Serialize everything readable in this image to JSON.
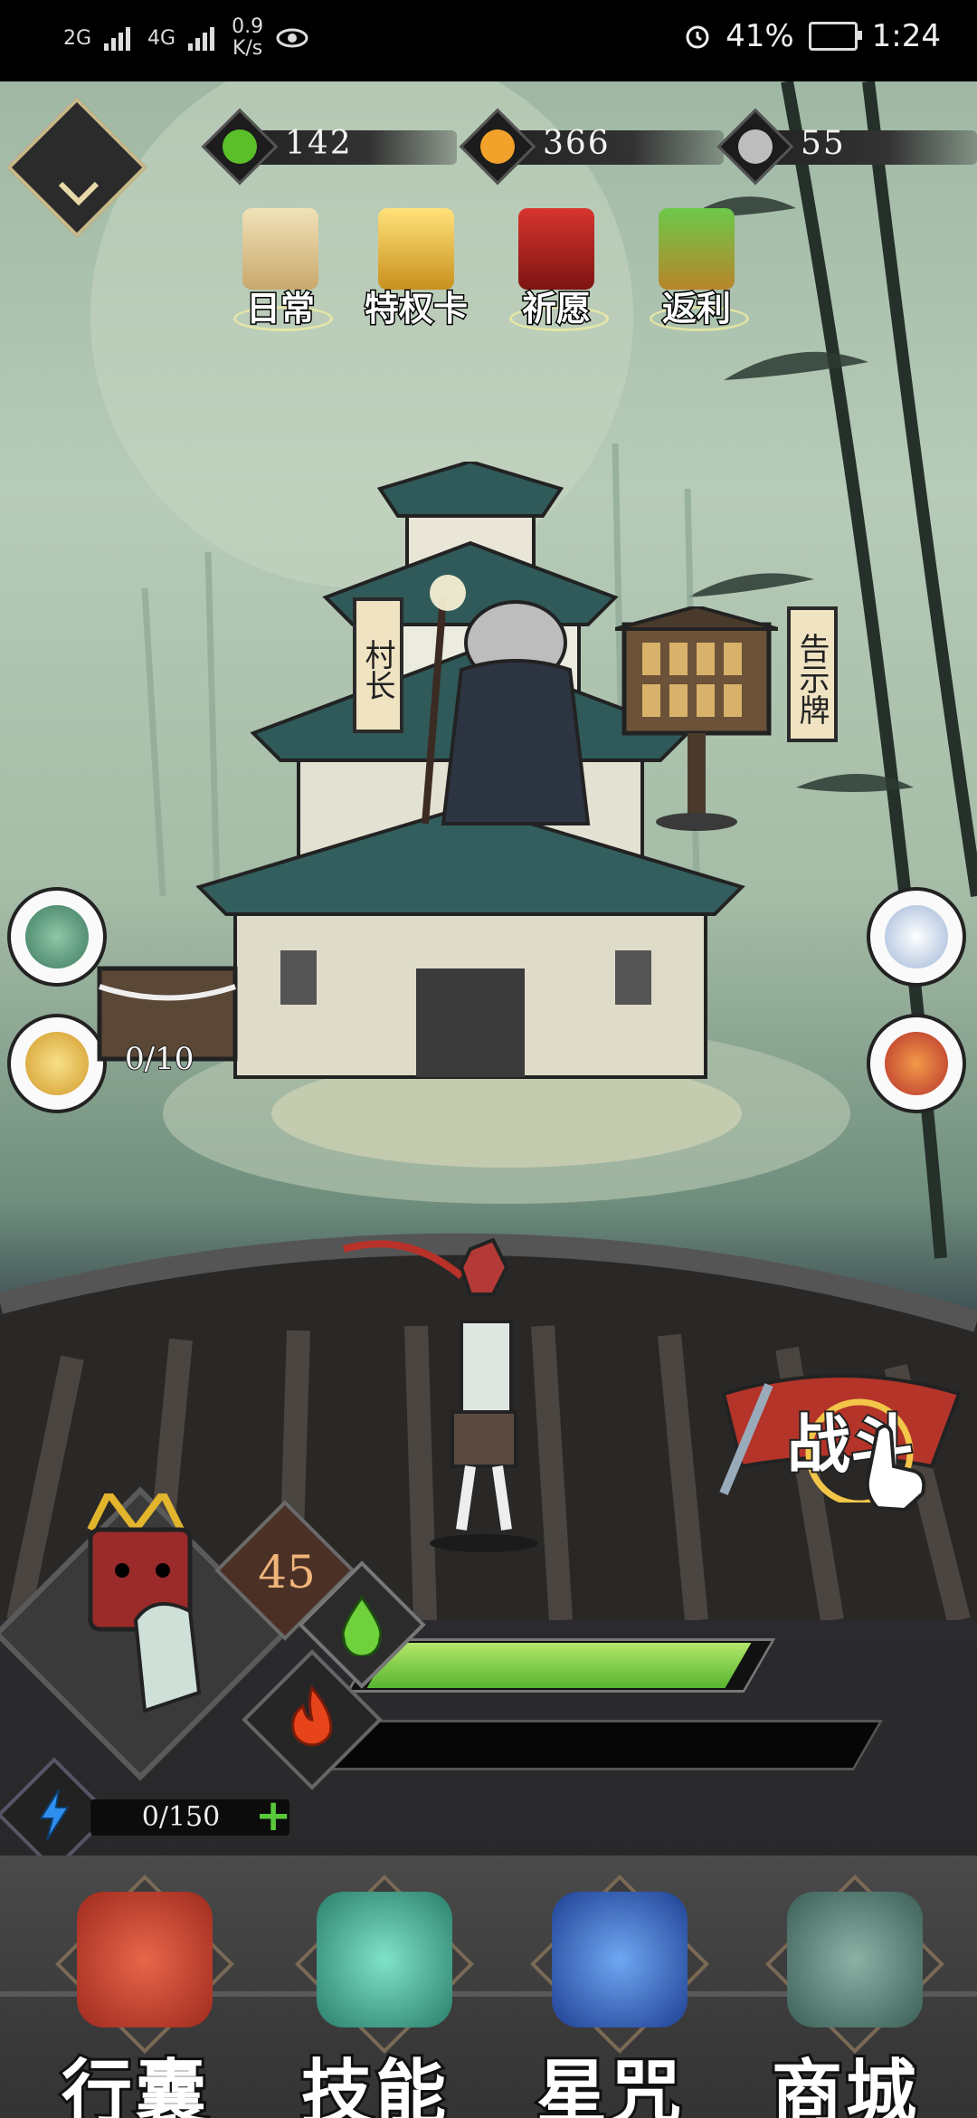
{
  "status_bar": {
    "net_type_1": "2G",
    "net_type_2": "4G",
    "speed": "0.9",
    "speed_unit": "K/s",
    "battery": "41%",
    "time": "1:24"
  },
  "currencies": [
    {
      "name": "jade",
      "value": "142",
      "color": "#5bbf2a"
    },
    {
      "name": "coin",
      "value": "366",
      "color": "#f2a12b"
    },
    {
      "name": "swirl",
      "value": "55",
      "color": "#bdbdbd"
    }
  ],
  "top_features": [
    {
      "label": "日常",
      "icon": "scroll-icon"
    },
    {
      "label": "特权卡",
      "icon": "gold-card-icon"
    },
    {
      "label": "祈愿",
      "icon": "torii-gate-icon"
    },
    {
      "label": "返利",
      "icon": "treasure-chest-icon"
    }
  ],
  "village": {
    "chief_sign": "村长",
    "notice_sign": "告示牌",
    "shrine_count": "0/10"
  },
  "battle": {
    "label": "战斗"
  },
  "player": {
    "level": "45",
    "hp_fraction": 0.86,
    "rage_fraction": 0.0,
    "energy": "0/150"
  },
  "bottom_nav": [
    {
      "label": "行囊",
      "icon": "bag-icon"
    },
    {
      "label": "技能",
      "icon": "blade-icon"
    },
    {
      "label": "星咒",
      "icon": "star-scroll-icon"
    },
    {
      "label": "商城",
      "icon": "shop-icon"
    }
  ]
}
